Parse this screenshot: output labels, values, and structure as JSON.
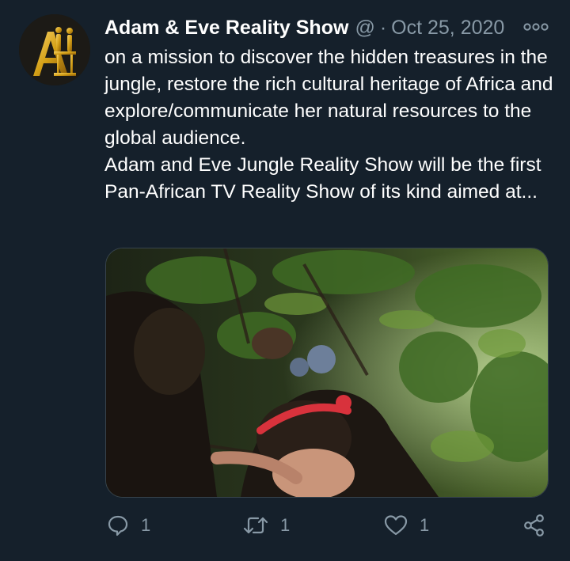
{
  "tweet": {
    "display_name": "Adam & Eve Reality Show",
    "handle": "@",
    "separator": "·",
    "date": "Oct 25, 2020",
    "body_lines": [
      "on a mission to discover the hidden treasures in the jungle, restore the rich cultural heritage of Africa and explore/communicate her natural resources to the global audience.",
      "Adam and Eve Jungle Reality Show will be the first Pan-African TV Reality Show of its kind aimed at..."
    ],
    "media": {
      "description_icon": "jungle-photo"
    }
  },
  "actions": {
    "reply_count": "1",
    "retweet_count": "1",
    "like_count": "1"
  },
  "colors": {
    "background": "#15202b",
    "secondary_text": "#8899a6",
    "avatar_gold": "#d4a017"
  }
}
